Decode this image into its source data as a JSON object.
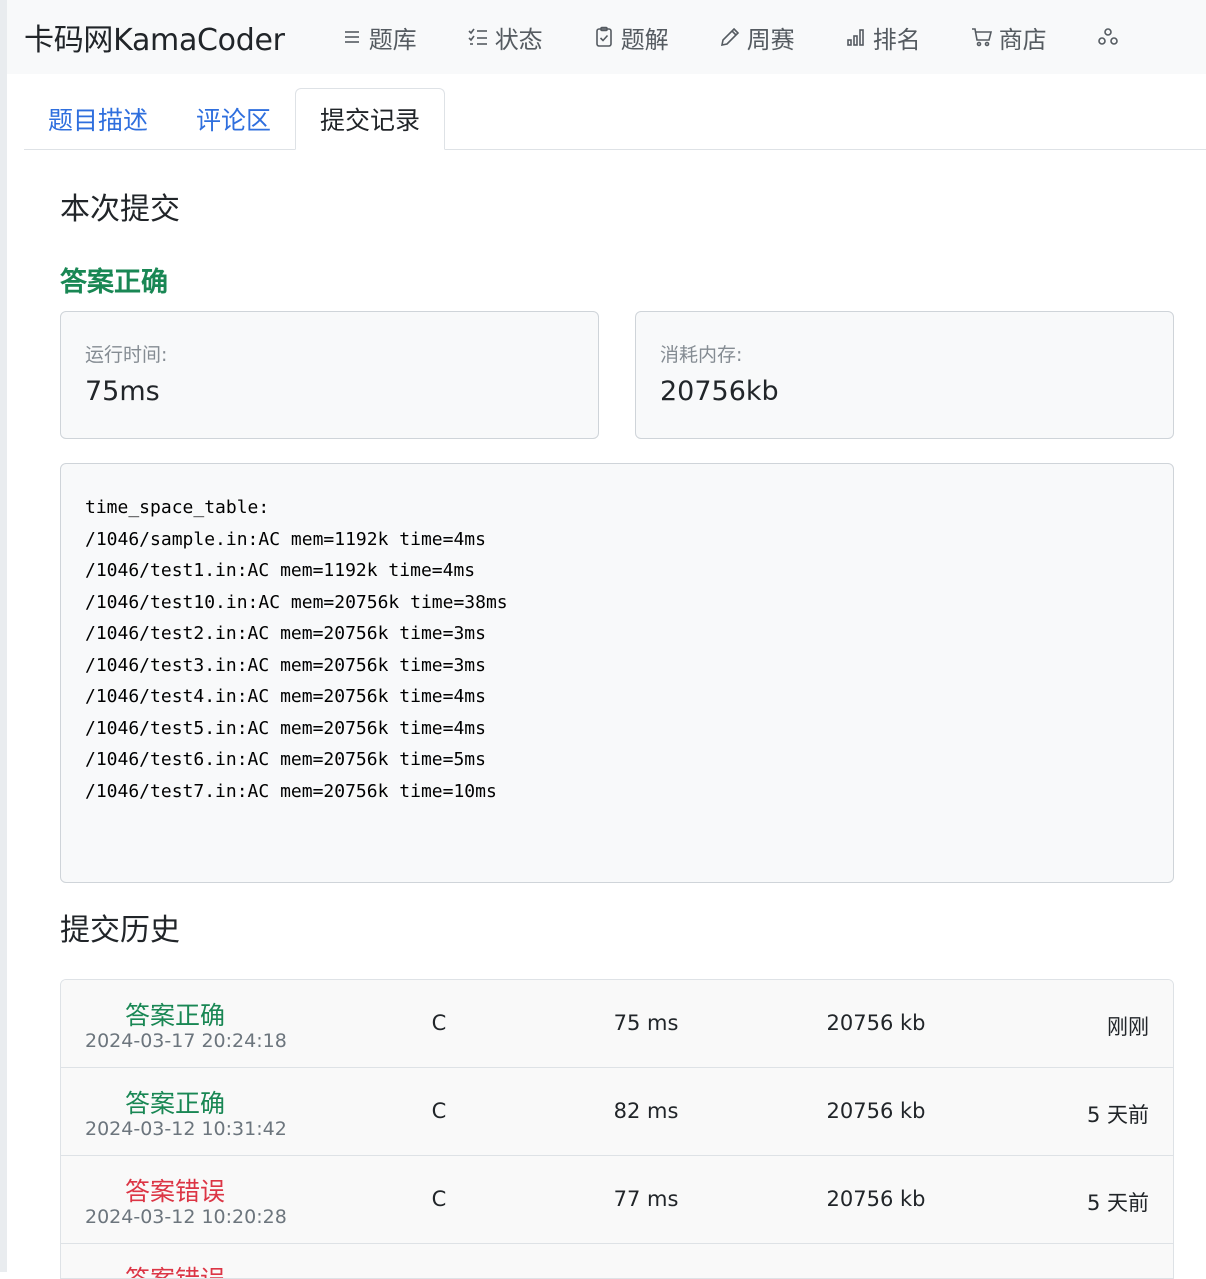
{
  "header": {
    "brand": "卡码网KamaCoder",
    "nav": [
      {
        "label": "题库",
        "icon": "list-icon"
      },
      {
        "label": "状态",
        "icon": "checklist-icon"
      },
      {
        "label": "题解",
        "icon": "clipboard-check-icon"
      },
      {
        "label": "周赛",
        "icon": "pencil-icon"
      },
      {
        "label": "排名",
        "icon": "bar-chart-icon"
      },
      {
        "label": "商店",
        "icon": "cart-icon"
      }
    ]
  },
  "tabs": [
    {
      "label": "题目描述",
      "active": false
    },
    {
      "label": "评论区",
      "active": false
    },
    {
      "label": "提交记录",
      "active": true
    }
  ],
  "current": {
    "section_title": "本次提交",
    "status": "答案正确",
    "status_color": "#198754",
    "runtime_label": "运行时间:",
    "runtime_value": "75ms",
    "memory_label": "消耗内存:",
    "memory_value": "20756kb"
  },
  "log": {
    "lines": [
      "time_space_table:",
      "/1046/sample.in:AC mem=1192k time=4ms",
      "/1046/test1.in:AC mem=1192k time=4ms",
      "/1046/test10.in:AC mem=20756k time=38ms",
      "/1046/test2.in:AC mem=20756k time=3ms",
      "/1046/test3.in:AC mem=20756k time=3ms",
      "/1046/test4.in:AC mem=20756k time=4ms",
      "/1046/test5.in:AC mem=20756k time=4ms",
      "/1046/test6.in:AC mem=20756k time=5ms",
      "/1046/test7.in:AC mem=20756k time=10ms"
    ]
  },
  "history": {
    "title": "提交历史",
    "rows": [
      {
        "result": "答案正确",
        "ok": true,
        "date": "2024-03-17 20:24:18",
        "lang": "C",
        "time": "75 ms",
        "mem": "20756 kb",
        "ago": "刚刚"
      },
      {
        "result": "答案正确",
        "ok": true,
        "date": "2024-03-12 10:31:42",
        "lang": "C",
        "time": "82 ms",
        "mem": "20756 kb",
        "ago": "5 天前"
      },
      {
        "result": "答案错误",
        "ok": false,
        "date": "2024-03-12 10:20:28",
        "lang": "C",
        "time": "77 ms",
        "mem": "20756 kb",
        "ago": "5 天前"
      },
      {
        "result": "答案错误",
        "ok": false,
        "date": "",
        "lang": "",
        "time": "",
        "mem": "",
        "ago": ""
      }
    ]
  },
  "colors": {
    "accent": "#2f6fde",
    "success": "#198754",
    "danger": "#dc3545"
  }
}
